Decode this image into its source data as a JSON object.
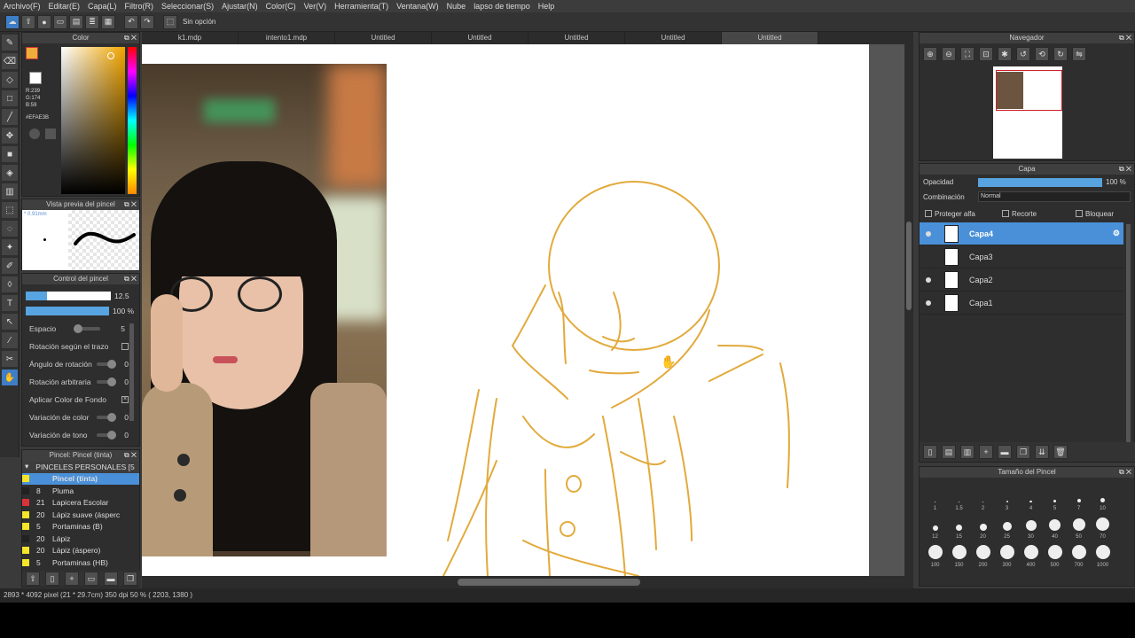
{
  "menu": [
    "Archivo(F)",
    "Editar(E)",
    "Capa(L)",
    "Filtro(R)",
    "Seleccionar(S)",
    "Ajustar(N)",
    "Color(C)",
    "Ver(V)",
    "Herramienta(T)",
    "Ventana(W)",
    "Nube",
    "lapso de tiempo",
    "Help"
  ],
  "toolbar": {
    "option_text": "Sin opción"
  },
  "tabs": [
    "k1.mdp",
    "intento1.mdp",
    "Untitled",
    "Untitled",
    "Untitled",
    "Untitled",
    "Untitled"
  ],
  "color_panel": {
    "title": "Color",
    "r": "R:239",
    "g": "G:174",
    "b": "B:59",
    "hex": "#EFAE3B",
    "main_color": "#EFAE3B"
  },
  "brush_preview": {
    "title": "Vista previa del pincel",
    "size": "* 0.91mm"
  },
  "brush_control": {
    "title": "Control del pincel",
    "size_value": "12.5",
    "opacity_value": "100 %",
    "spacing_label": "Espacio",
    "spacing_value": "5",
    "rotation_stroke": "Rotación según el trazo",
    "rotation_angle": "Ángulo de rotación",
    "rotation_angle_value": "0",
    "rotation_random": "Rotación arbitraria",
    "rotation_random_value": "0",
    "apply_bg": "Aplicar Color de Fondo",
    "color_var": "Variación de color",
    "color_var_value": "0",
    "tone_var": "Variación de tono",
    "tone_var_value": "0"
  },
  "brush_list": {
    "title": "Pincel: Pincel (tinta)",
    "group": "PINCELES PERSONALES [5",
    "items": [
      {
        "size": "",
        "name": "Pincel (tinta)",
        "color": "#f5e52a"
      },
      {
        "size": "8",
        "name": "Pluma",
        "color": "#222222"
      },
      {
        "size": "21",
        "name": "Lapicera Escolar",
        "color": "#d8343a"
      },
      {
        "size": "20",
        "name": "Lápiz suave (ásperc",
        "color": "#f5e52a"
      },
      {
        "size": "5",
        "name": "Portaminas (B)",
        "color": "#f5e52a"
      },
      {
        "size": "20",
        "name": "Lápiz",
        "color": "#222222"
      },
      {
        "size": "20",
        "name": "Lápiz (áspero)",
        "color": "#f5e52a"
      },
      {
        "size": "5",
        "name": "Portaminas (HB)",
        "color": "#f5e52a"
      }
    ]
  },
  "navigator": {
    "title": "Navegador"
  },
  "layer_panel": {
    "title": "Capa",
    "opacity_label": "Opacidad",
    "opacity_value": "100 %",
    "blend_label": "Combinación",
    "blend_value": "Normal",
    "protect_alpha": "Proteger alfa",
    "clip": "Recorte",
    "lock": "Bloquear",
    "layers": [
      {
        "name": "Capa4",
        "visible": true,
        "selected": true
      },
      {
        "name": "Capa3",
        "visible": false,
        "selected": false
      },
      {
        "name": "Capa2",
        "visible": true,
        "selected": false
      },
      {
        "name": "Capa1",
        "visible": true,
        "selected": false
      }
    ]
  },
  "brush_size_panel": {
    "title": "Tamaño del Pincel",
    "sizes": [
      "1",
      "1.5",
      "2",
      "3",
      "4",
      "5",
      "7",
      "10",
      "12",
      "15",
      "20",
      "25",
      "30",
      "40",
      "50",
      "70",
      "100",
      "150",
      "200",
      "300",
      "400",
      "500",
      "700",
      "1000"
    ]
  },
  "status": "2893 * 4092 pixel   (21 * 29.7cm)   350 dpi   50 %   ( 2203, 1380 )"
}
